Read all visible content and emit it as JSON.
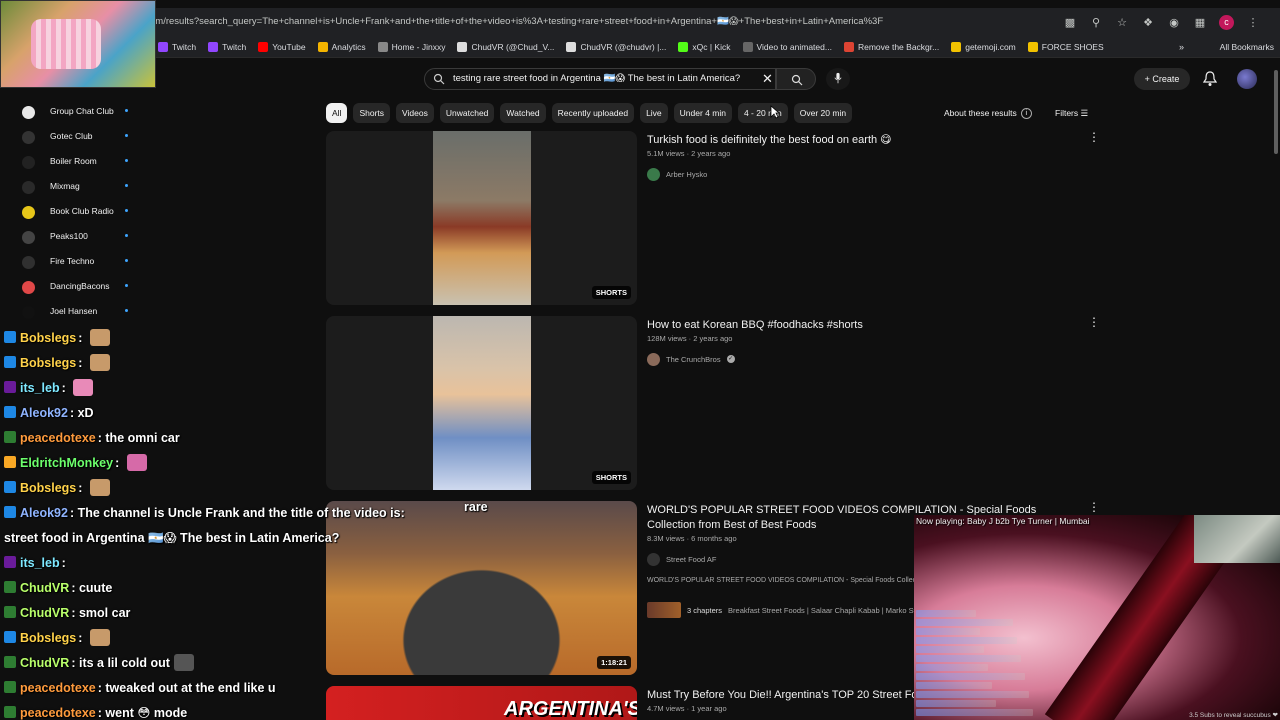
{
  "browser": {
    "url": "om/results?search_query=The+channel+is+Uncle+Frank+and+the+title+of+the+video+is%3A+testing+rare+street+food+in+Argentina+🇦🇷😱+The+best+in+Latin+America%3F",
    "bookmarks": [
      "Twitch",
      "Twitch",
      "YouTube",
      "Analytics",
      "Home - Jinxxy",
      "ChudVR (@Chud_V...",
      "ChudVR (@chudvr) |...",
      "xQc | Kick",
      "Video to animated...",
      "Remove the Backgr...",
      "getemoji.com",
      "FORCE SHOES"
    ],
    "all_bookmarks": "All Bookmarks",
    "more_chevron": "»",
    "profile_initial": "c"
  },
  "youtube": {
    "search_query": "testing rare street food in Argentina 🇦🇷😱 The best in Latin America?",
    "create_label": "Create",
    "chips": [
      "All",
      "Shorts",
      "Videos",
      "Unwatched",
      "Watched",
      "Recently uploaded",
      "Live",
      "Under 4 min",
      "4 - 20 min",
      "Over 20 min"
    ],
    "about_results": "About these results",
    "filters_label": "Filters",
    "sidebar_subs": [
      {
        "name": "Group Chat Club",
        "color": "#e8e8e8"
      },
      {
        "name": "Gotec Club",
        "color": "#333333"
      },
      {
        "name": "Boiler Room",
        "color": "#222222"
      },
      {
        "name": "Mixmag",
        "color": "#2a2a2a"
      },
      {
        "name": "Book Club Radio",
        "color": "#e6c619"
      },
      {
        "name": "Peaks100",
        "color": "#444444"
      },
      {
        "name": "Fire Techno",
        "color": "#303030"
      },
      {
        "name": "DancingBacons",
        "color": "#e04848"
      },
      {
        "name": "Joel Hansen",
        "color": "#111111"
      }
    ],
    "results": [
      {
        "title": "Turkish food is deifinitely the best food on earth 😋",
        "meta": "5.1M views · 2 years ago",
        "channel": "Arber Hysko",
        "badge": "SHORTS"
      },
      {
        "title": "How to eat Korean BBQ #foodhacks #shorts",
        "meta": "128M views · 2 years ago",
        "channel": "The CrunchBros",
        "badge": "SHORTS"
      },
      {
        "title": "WORLD'S POPULAR STREET FOOD VIDEOS COMPILATION - Special Foods Collection from Best of Best Foods",
        "meta": "8.3M views · 6 months ago",
        "channel": "Street Food AF",
        "snippet": "WORLD'S POPULAR STREET FOOD VIDEOS COMPILATION - Special Foods Collec",
        "chapters": "3 chapters",
        "chapter_text": "Breakfast Street Foods | Salaar Chapli Kabab | Marko St",
        "duration": "1:18:21"
      },
      {
        "title": "Must Try Before You Die!! Argentina's TOP 20 Street Fo",
        "meta": "4.7M views · 1 year ago",
        "thumb_text": "ARGENTINA'S"
      }
    ]
  },
  "chat": [
    {
      "user": "Bobslegs",
      "sep": ":",
      "text": "",
      "color": "#ffd24a",
      "emote": "#c79a6a"
    },
    {
      "user": "Bobslegs",
      "sep": ":",
      "text": "",
      "color": "#ffd24a",
      "emote": "#c79a6a"
    },
    {
      "user": "its_leb",
      "sep": ":",
      "text": "",
      "color": "#7ee8ff",
      "emote": "#e88ab8"
    },
    {
      "user": "Aleok92",
      "sep": ":",
      "text": "xD",
      "color": "#8fb4ff",
      "emote": ""
    },
    {
      "user": "peacedotexe",
      "sep": ":",
      "text": "the omni car",
      "color": "#ff9b3d",
      "emote": ""
    },
    {
      "user": "EldritchMonkey",
      "sep": ":",
      "text": "",
      "color": "#6cff6c",
      "emote": "#d66aa8"
    },
    {
      "user": "Bobslegs",
      "sep": ":",
      "text": "",
      "color": "#ffd24a",
      "emote": "#c79a6a"
    },
    {
      "user": "Aleok92",
      "sep": ":",
      "text": "The channel is Uncle Frank and the title of the video is:",
      "color": "#8fb4ff",
      "emote": ""
    },
    {
      "user": "",
      "sep": "",
      "text": "street food in Argentina 🇦🇷😱 The best in Latin America?",
      "color": "#ffffff",
      "emote": ""
    },
    {
      "user": "its_leb",
      "sep": ":",
      "text": "",
      "color": "#7ee8ff",
      "emote": ""
    },
    {
      "user": "ChudVR",
      "sep": ":",
      "text": "cuute",
      "color": "#b9ff6b",
      "emote": ""
    },
    {
      "user": "ChudVR",
      "sep": ":",
      "text": "smol car",
      "color": "#b9ff6b",
      "emote": ""
    },
    {
      "user": "Bobslegs",
      "sep": ":",
      "text": "",
      "color": "#ffd24a",
      "emote": "#c79a6a"
    },
    {
      "user": "ChudVR",
      "sep": ":",
      "text": "its a lil cold out",
      "color": "#b9ff6b",
      "emote": "#555555"
    },
    {
      "user": "peacedotexe",
      "sep": ":",
      "text": "tweaked out at the end like u",
      "color": "#ff9b3d",
      "emote": ""
    },
    {
      "user": "peacedotexe",
      "sep": ":",
      "text": "went 😳 mode",
      "color": "#ff9b3d",
      "emote": ""
    }
  ],
  "chat_extra": {
    "rare_word": "rare"
  },
  "now_playing": {
    "text": "Now playing: Baby J b2b Tye Turner | Mumbai",
    "footer": "3.5 Subs to reveal succubus ❤"
  },
  "colors": {
    "youtube_bg": "#0f0f0f",
    "chip_active": "#f1f1f1",
    "chip": "#272727"
  }
}
